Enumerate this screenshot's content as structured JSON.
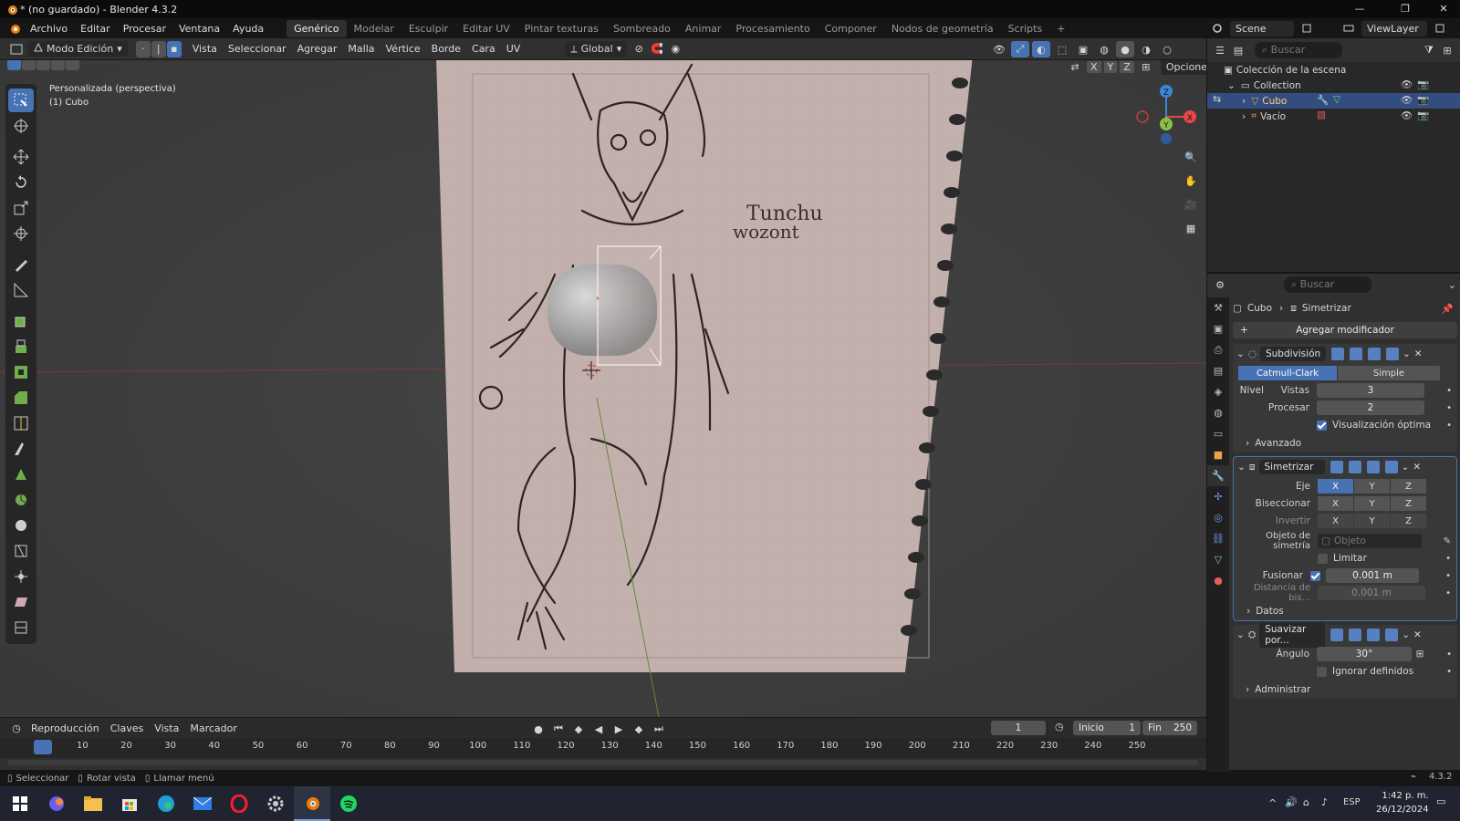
{
  "window": {
    "title": "* (no guardado) - Blender 4.3.2",
    "minimize": "—",
    "restore": "❐",
    "close": "✕"
  },
  "menus": [
    "Archivo",
    "Editar",
    "Procesar",
    "Ventana",
    "Ayuda"
  ],
  "workspaces": [
    "Genérico",
    "Modelar",
    "Esculpir",
    "Editar UV",
    "Pintar texturas",
    "Sombreado",
    "Animar",
    "Procesamiento",
    "Componer",
    "Nodos de geometría",
    "Scripts"
  ],
  "active_workspace": "Genérico",
  "add_tab": "+",
  "scene": {
    "name": "Scene",
    "viewlayer": "ViewLayer"
  },
  "viewport_header": {
    "mode": "Modo Edición",
    "menu": [
      "Vista",
      "Seleccionar",
      "Agregar",
      "Malla",
      "Vértice",
      "Borde",
      "Cara",
      "UV"
    ],
    "orientation": "Global",
    "axes": [
      "X",
      "Y",
      "Z"
    ],
    "options": "Opciones"
  },
  "viewport": {
    "view_name": "Personalizada (perspectiva)",
    "object_name": "(1) Cubo",
    "drawing_text": [
      "Tunchu",
      "wozont"
    ],
    "gizmo": {
      "x": "X",
      "y": "Y",
      "z": "Z"
    }
  },
  "outliner": {
    "search_placeholder": "Buscar",
    "root": "Colección de la escena",
    "collection": "Collection",
    "items": [
      {
        "name": "Cubo",
        "selected": true
      },
      {
        "name": "Vacío",
        "selected": false
      }
    ]
  },
  "properties": {
    "search_placeholder": "Buscar",
    "breadcrumb_object": "Cubo",
    "breadcrumb_modifier": "Simetrizar",
    "add_modifier": "Agregar modificador",
    "subdivision": {
      "name": "Subdivisión",
      "type_on": "Catmull-Clark",
      "type_off": "Simple",
      "level_label": "Nivel",
      "views_label": "Vistas",
      "views": "3",
      "render_label": "Procesar",
      "render": "2",
      "optimal_label": "Visualización óptima",
      "advanced": "Avanzado"
    },
    "mirror": {
      "name": "Simetrizar",
      "axis_label": "Eje",
      "bisect_label": "Biseccionar",
      "invert_label": "Invertir",
      "mirror_obj_label": "Objeto de simetría",
      "mirror_obj_placeholder": "Objeto",
      "clip_label": "Limitar",
      "merge_label": "Fusionar",
      "merge_value": "0.001 m",
      "bisect_dist_label": "Distancia de bis...",
      "bisect_dist_value": "0.001 m",
      "data": "Datos"
    },
    "smooth": {
      "name": "Suavizar por...",
      "angle_label": "Ángulo",
      "angle_value": "30°",
      "ignore_label": "Ignorar definidos",
      "manage": "Administrar"
    }
  },
  "timeline": {
    "menu": [
      "Reproducción",
      "Claves",
      "Vista",
      "Marcador"
    ],
    "current_frame": "1",
    "start_label": "Inicio",
    "start": "1",
    "end_label": "Fin",
    "end": "250",
    "ticks": [
      "1",
      "10",
      "20",
      "30",
      "40",
      "50",
      "60",
      "70",
      "80",
      "90",
      "100",
      "110",
      "120",
      "130",
      "140",
      "150",
      "160",
      "170",
      "180",
      "190",
      "200",
      "210",
      "220",
      "230",
      "240",
      "250"
    ]
  },
  "status": {
    "select": "Seleccionar",
    "rotate": "Rotar vista",
    "menu": "Llamar menú",
    "version": "4.3.2"
  },
  "taskbar": {
    "lang": "ESP",
    "time": "1:42 p. m.",
    "date": "26/12/2024"
  },
  "colors": {
    "accent": "#4772b3",
    "selected_row": "#334d80",
    "x_axis": "#e8464b",
    "y_axis": "#8ac04a",
    "z_axis": "#3c86d8"
  }
}
